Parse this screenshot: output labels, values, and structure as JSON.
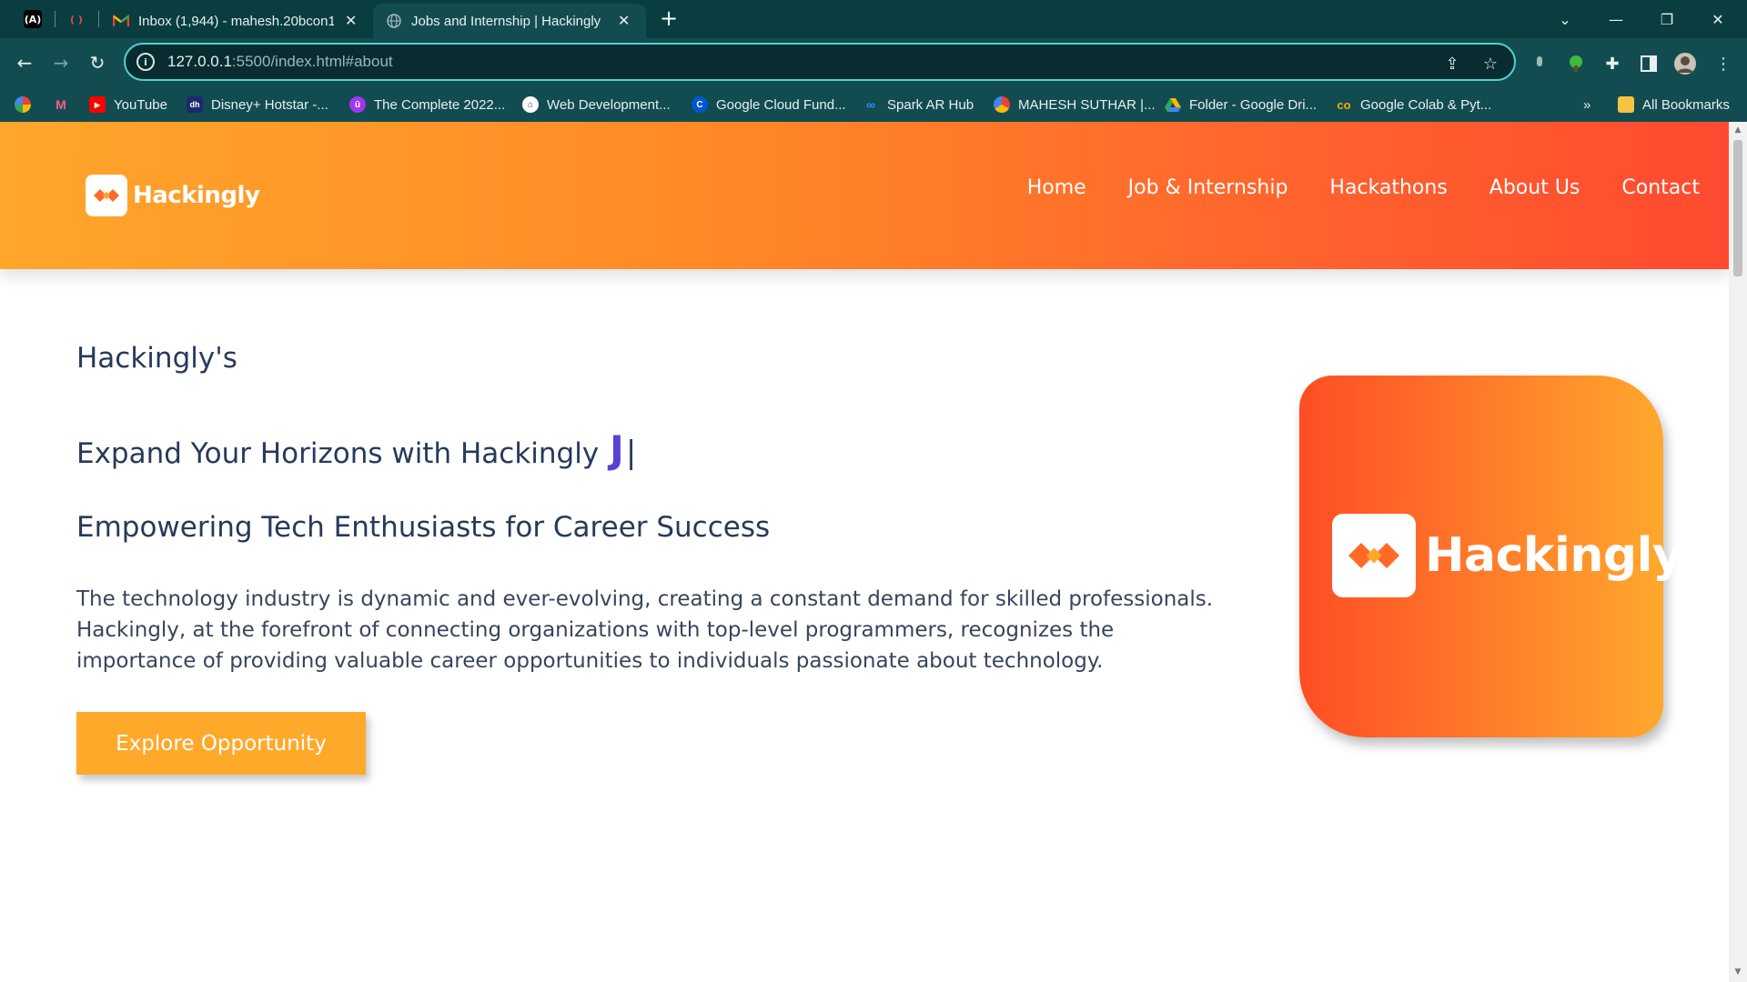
{
  "browser": {
    "tabs": [
      {
        "title": "Inbox (1,944) - mahesh.20bcon1",
        "favicon": "gmail-icon",
        "active": false
      },
      {
        "title": "Jobs and Internship | Hackingly",
        "favicon": "globe-icon",
        "active": true
      }
    ],
    "new_tab": "+",
    "window_controls": {
      "tab_search": "⌄",
      "minimize": "—",
      "restore": "❐",
      "close": "✕"
    },
    "url_host": "127.0.0.1",
    "url_rest": ":5500/index.html#about",
    "bookmarks": [
      {
        "label": "",
        "icon": "pinwheel-icon"
      },
      {
        "label": "",
        "icon": "m-icon"
      },
      {
        "label": "YouTube",
        "icon": "youtube-icon"
      },
      {
        "label": "Disney+ Hotstar -...",
        "icon": "hotstar-icon"
      },
      {
        "label": "The Complete 2022...",
        "icon": "udemy-icon"
      },
      {
        "label": "Web Development...",
        "icon": "webdev-icon"
      },
      {
        "label": "Google Cloud Fund...",
        "icon": "coursera-icon"
      },
      {
        "label": "Spark AR Hub",
        "icon": "meta-icon"
      },
      {
        "label": "MAHESH SUTHAR |...",
        "icon": "cloud-icon"
      },
      {
        "label": "Folder - Google Dri...",
        "icon": "drive-icon"
      },
      {
        "label": "Google Colab & Pyt...",
        "icon": "colab-icon"
      }
    ],
    "bookmarks_overflow": "»",
    "all_bookmarks": "All Bookmarks"
  },
  "site": {
    "logo_text": "Hackingly",
    "nav": [
      "Home",
      "Job & Internship",
      "Hackathons",
      "About Us",
      "Contact"
    ],
    "hero": {
      "kicker": "Hackingly's",
      "title": "Expand Your Horizons with Hackingly",
      "typed": "J",
      "cursor": "|",
      "subtitle": "Empowering Tech Enthusiasts for Career Success",
      "description": "The technology industry is dynamic and ever-evolving, creating a constant demand for skilled professionals. Hackingly, at the forefront of connecting organizations with top-level programmers, recognizes the importance of providing valuable career opportunities to individuals passionate about technology.",
      "cta": "Explore Opportunity"
    },
    "card_logo_text": "Hackingly"
  },
  "colors": {
    "header_gradient_start": "#ffa62b",
    "header_gradient_end": "#ff4a2f",
    "cta": "#ffa92b",
    "heading_text": "#283a5a",
    "typed_accent": "#5b3fd6",
    "browser_chrome": "#124c50"
  }
}
